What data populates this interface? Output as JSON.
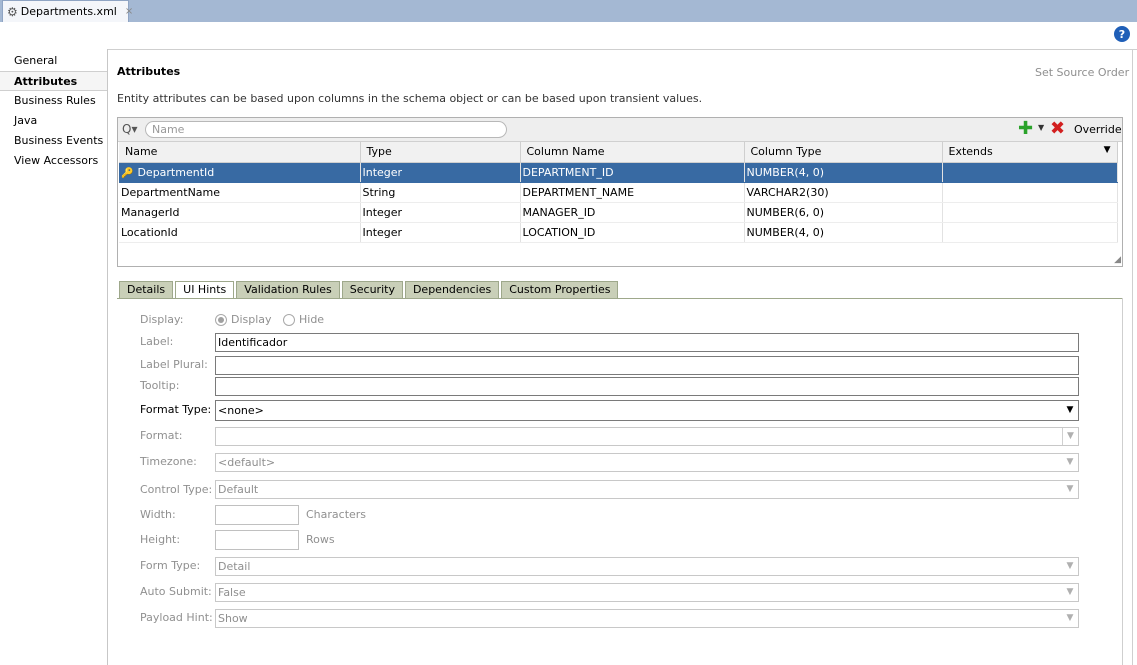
{
  "editor_tab": {
    "title": "Departments.xml",
    "close": "×"
  },
  "help": {
    "label": "?"
  },
  "nav": {
    "items": [
      {
        "label": "General"
      },
      {
        "label": "Attributes"
      },
      {
        "label": "Business Rules"
      },
      {
        "label": "Java"
      },
      {
        "label": "Business Events"
      },
      {
        "label": "View Accessors"
      }
    ]
  },
  "header": {
    "title": "Attributes",
    "set_source_order": "Set Source Order",
    "description": "Entity attributes can be based upon columns in the schema object or can be based upon transient values."
  },
  "toolbar": {
    "search_placeholder": "Name",
    "search_icon": "Q▾",
    "add_icon": "✚",
    "add_dropdown": "▼",
    "delete_icon": "✖",
    "override": "Override"
  },
  "attributes_table": {
    "columns": [
      "Name",
      "Type",
      "Column Name",
      "Column Type",
      "Extends"
    ],
    "sort_arrow": "▼",
    "rows": [
      {
        "name": "DepartmentId",
        "type": "Integer",
        "column_name": "DEPARTMENT_ID",
        "column_type": "NUMBER(4, 0)",
        "extends": ""
      },
      {
        "name": "DepartmentName",
        "type": "String",
        "column_name": "DEPARTMENT_NAME",
        "column_type": "VARCHAR2(30)",
        "extends": ""
      },
      {
        "name": "ManagerId",
        "type": "Integer",
        "column_name": "MANAGER_ID",
        "column_type": "NUMBER(6, 0)",
        "extends": ""
      },
      {
        "name": "LocationId",
        "type": "Integer",
        "column_name": "LOCATION_ID",
        "column_type": "NUMBER(4, 0)",
        "extends": ""
      }
    ]
  },
  "property_tabs": [
    "Details",
    "UI Hints",
    "Validation Rules",
    "Security",
    "Dependencies",
    "Custom Properties"
  ],
  "form": {
    "display": {
      "label": "Display:",
      "option_display": "Display",
      "option_hide": "Hide"
    },
    "label": {
      "label": "Label:",
      "value": "Identificador"
    },
    "label_plural": {
      "label": "Label Plural:",
      "value": ""
    },
    "tooltip": {
      "label": "Tooltip:",
      "value": ""
    },
    "format_type": {
      "label": "Format Type:",
      "value": "<none>"
    },
    "format": {
      "label": "Format:",
      "value": ""
    },
    "timezone": {
      "label": "Timezone:",
      "value": "<default>"
    },
    "control_type": {
      "label": "Control Type:",
      "value": "Default"
    },
    "width": {
      "label": "Width:",
      "unit": "Characters"
    },
    "height": {
      "label": "Height:",
      "unit": "Rows"
    },
    "form_type": {
      "label": "Form Type:",
      "value": "Detail"
    },
    "auto_submit": {
      "label": "Auto Submit:",
      "value": "False"
    },
    "payload_hint": {
      "label": "Payload Hint:",
      "value": "Show"
    }
  },
  "colors": {
    "selection": "#386aa3",
    "tab_bg": "#c9cfb8",
    "tabstrip": "#a4b8d3",
    "accent_add": "#2aa22a",
    "accent_delete": "#d21f1f"
  }
}
